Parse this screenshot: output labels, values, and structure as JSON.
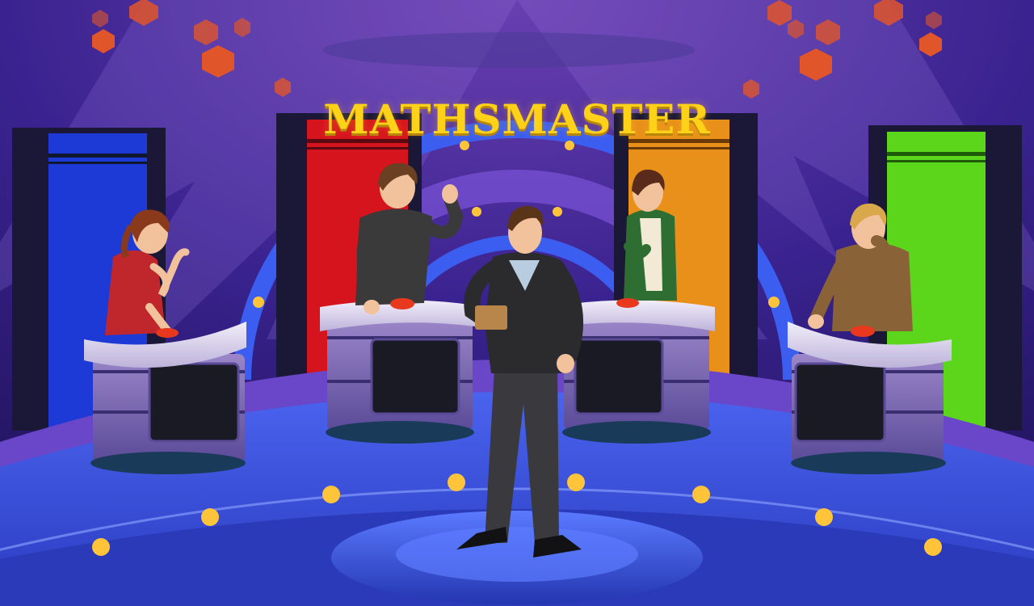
{
  "game": {
    "title": "MATHSMASTER"
  },
  "colors": {
    "background": "#2a1a6e",
    "stage_floor": "#3e56e0",
    "title": "#ffd21a",
    "panel_blue": "#1e3ad6",
    "panel_red": "#d6141e",
    "panel_orange": "#e8901a",
    "panel_green": "#5cd61a",
    "buzzer": "#e8381e"
  },
  "scene": {
    "backdrop_panels": [
      "blue",
      "red",
      "orange",
      "green"
    ],
    "contestants": [
      {
        "role": "contestant-1",
        "shirt_color": "#c0272d"
      },
      {
        "role": "contestant-2",
        "shirt_color": "#3a3a3a"
      },
      {
        "role": "contestant-3",
        "shirt_color": "#2f6e33"
      },
      {
        "role": "contestant-4",
        "shirt_color": "#8a6238"
      }
    ],
    "host": {
      "role": "host",
      "suit_color": "#2b2b2e"
    }
  }
}
